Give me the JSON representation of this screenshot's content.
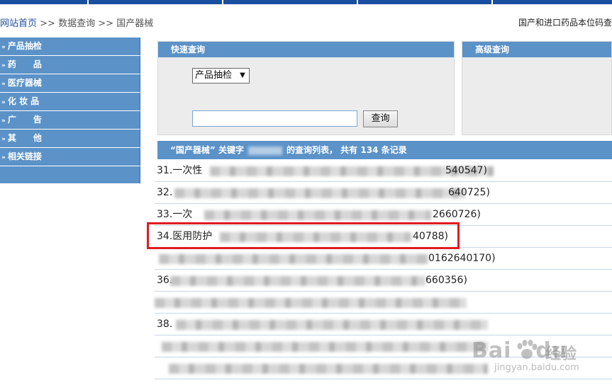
{
  "breadcrumb": {
    "home": "网站首页",
    "sep1": ">>",
    "data_query": "数据查询",
    "sep2": ">>",
    "current": "国产器械"
  },
  "notice": "国产和进口药品本位码查",
  "sidebar": {
    "items": [
      {
        "label": "产品抽检"
      },
      {
        "label": "药　　品"
      },
      {
        "label": "医疗器械"
      },
      {
        "label": "化 妆 品"
      },
      {
        "label": "广　　告"
      },
      {
        "label": "其　　他"
      },
      {
        "label": "相关链接"
      }
    ],
    "arrow_glyph": "»"
  },
  "quick_search": {
    "title": "快速查询",
    "select_value": "产品抽检",
    "input_value": "",
    "button_label": "查询"
  },
  "advanced_search": {
    "title": "高级查询"
  },
  "results": {
    "header_prefix": "“国产器械” 关键字",
    "header_mid": "的查询列表，",
    "header_count_text": "共有",
    "count": "134",
    "header_suffix": "条记录",
    "rows": [
      {
        "prefix": "31.一次性",
        "suffix": "540547)"
      },
      {
        "prefix": "32.",
        "suffix": "640725)"
      },
      {
        "prefix": "33.一次",
        "suffix": "2660726)"
      },
      {
        "prefix": "34.医用防护",
        "suffix": "40788)"
      },
      {
        "prefix": "",
        "suffix": "0162640170)"
      },
      {
        "prefix": "36.",
        "suffix": "660356)"
      },
      {
        "prefix": "",
        "suffix": ""
      },
      {
        "prefix": "38.",
        "suffix": ""
      },
      {
        "prefix": "",
        "suffix": ""
      },
      {
        "prefix": "",
        "suffix": ""
      }
    ]
  },
  "watermark": {
    "logo": "Bai",
    "logo_tail": "du",
    "cn": "经验",
    "url": "jingyan.baidu.com"
  },
  "colors": {
    "nav_blue": "#5b92c8",
    "top_bar": "#1a4e9e",
    "highlight_red": "#e11a22",
    "link_blue": "#1f4f9a"
  }
}
